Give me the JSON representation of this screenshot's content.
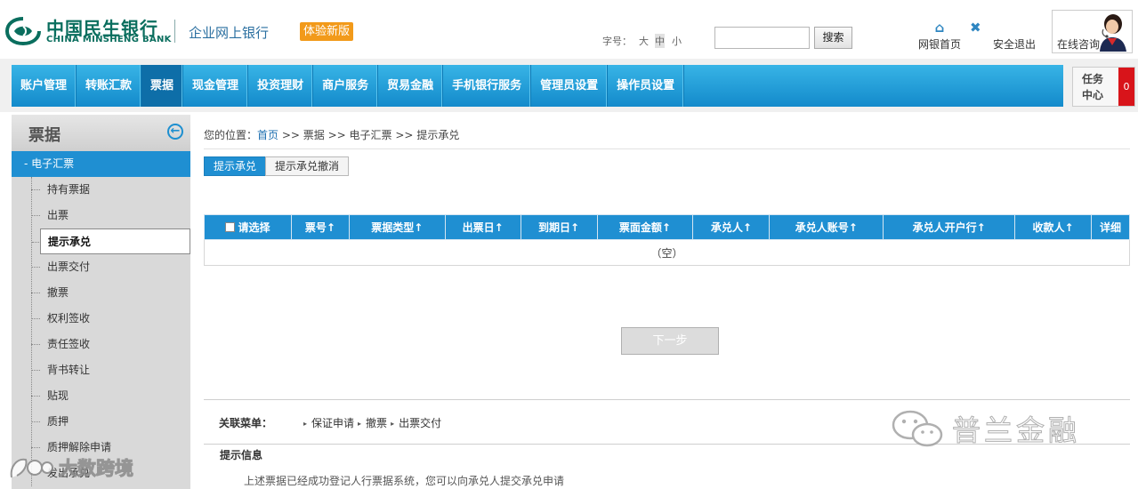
{
  "header": {
    "bank_name_cn": "中国民生银行",
    "bank_name_en": "CHINA MINSHENG BANK",
    "portal_name": "企业网上银行",
    "trial_badge": "体验新版",
    "font_size_label": "字号：",
    "font_sizes": [
      "大",
      "中",
      "小"
    ],
    "font_size_selected": "中",
    "search_placeholder": "",
    "search_button": "搜索",
    "home_link": "网银首页",
    "logout_link": "安全退出",
    "consult_label": "在线咨询"
  },
  "nav": {
    "items": [
      "账户管理",
      "转账汇款",
      "票据",
      "现金管理",
      "投资理财",
      "商户服务",
      "贸易金融",
      "手机银行服务",
      "管理员设置",
      "操作员设置"
    ],
    "active": "票据",
    "task_label": "任务中心",
    "task_count": "0"
  },
  "sidebar": {
    "title": "票据",
    "group": "- 电子汇票",
    "items": [
      "持有票据",
      "出票",
      "提示承兑",
      "出票交付",
      "撤票",
      "权利签收",
      "责任签收",
      "背书转让",
      "贴现",
      "质押",
      "质押解除申请",
      "发出承兑"
    ],
    "active": "提示承兑"
  },
  "breadcrumb": {
    "prefix": "您的位置：",
    "home": "首页",
    "sep": " >> ",
    "path": [
      "票据",
      "电子汇票",
      "提示承兑"
    ]
  },
  "subtabs": [
    "提示承兑",
    "提示承兑撤消"
  ],
  "table": {
    "select_all": "请选择",
    "columns": [
      "票号↑",
      "票据类型↑",
      "出票日↑",
      "到期日↑",
      "票面金额↑",
      "承兑人↑",
      "承兑人账号↑",
      "承兑人开户行↑",
      "收款人↑",
      "详细"
    ],
    "empty_text": "（空）"
  },
  "next_button": "下一步",
  "related": {
    "label": "关联菜单：",
    "links": [
      "保证申请",
      "撤票",
      "出票交付"
    ]
  },
  "tips": {
    "title": "提示信息",
    "text": "上述票据已经成功登记人行票据系统，您可以向承兑人提交承兑申请"
  },
  "watermarks": {
    "right": "普兰金融",
    "left": "大数跨境"
  },
  "colors": {
    "nav_blue": "#1f8fd2",
    "brand_green": "#0a6e5e",
    "badge_orange": "#f29a1a",
    "task_red": "#d8141a"
  }
}
